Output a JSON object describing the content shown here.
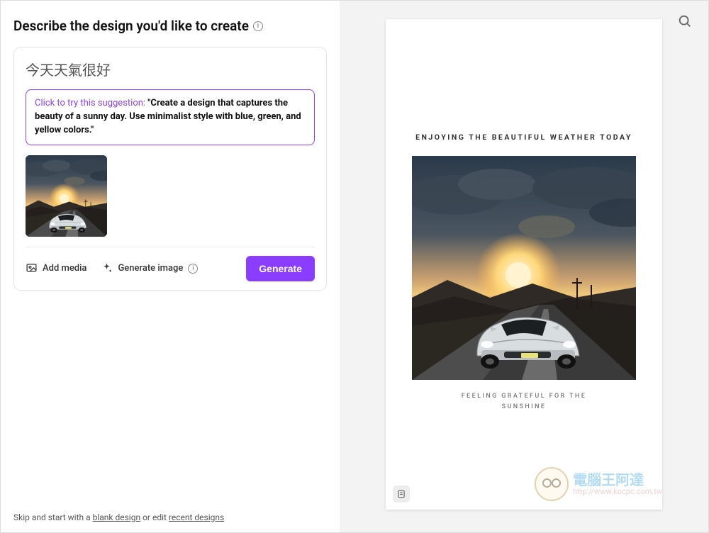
{
  "left": {
    "heading": "Describe the design you'd like to create",
    "prompt_value": "今天天氣很好",
    "suggestion_prefix": "Click to try this suggestion: ",
    "suggestion_body": "\"Create a design that captures the beauty of a sunny day. Use minimalist style with blue, green, and yellow colors.\"",
    "add_media_label": "Add media",
    "generate_image_label": "Generate image",
    "generate_button_label": "Generate",
    "footer_prefix": "Skip and start with a ",
    "footer_link_blank": "blank design",
    "footer_mid": " or edit ",
    "footer_link_recent": "recent designs"
  },
  "preview": {
    "title": "ENJOYING THE BEAUTIFUL WEATHER TODAY",
    "subtitle_line1": "FEELING GRATEFUL FOR THE",
    "subtitle_line2": "SUNSHINE"
  },
  "watermark": {
    "line1": "電腦王阿達",
    "line2": "http://www.kocpc.com.tw"
  }
}
